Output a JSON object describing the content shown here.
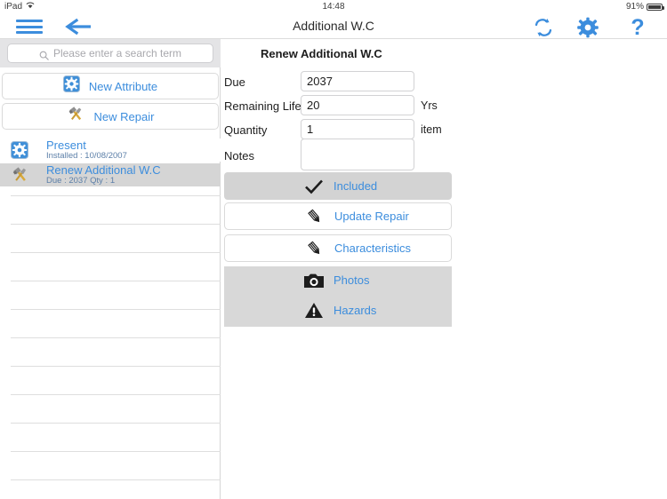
{
  "statusbar": {
    "device": "iPad",
    "wifi_icon": "wifi-icon",
    "time": "14:48",
    "battery_pct": "91%",
    "battery_icon": "battery-icon"
  },
  "navbar": {
    "menu_icon": "hamburger-menu-icon",
    "back_icon": "back-arrow-icon",
    "title": "Additional W.C",
    "sync_icon": "sync-icon",
    "settings_icon": "gear-icon",
    "help_icon": "question-mark-icon",
    "help_label": "?"
  },
  "sidebar": {
    "search": {
      "placeholder": "Please enter a search term",
      "value": "",
      "icon": "search-icon"
    },
    "actions": [
      {
        "label": "New Attribute",
        "icon": "blue-gear-square-icon"
      },
      {
        "label": "New Repair",
        "icon": "tools-icon"
      }
    ],
    "items": [
      {
        "title": "Present",
        "subtitle": "Installed : 10/08/2007",
        "icon": "blue-gear-square-icon",
        "selected": false
      },
      {
        "title": "Renew Additional W.C",
        "subtitle": "Due : 2037   Qty : 1",
        "icon": "tools-icon",
        "selected": true
      }
    ],
    "empty_row_count": 11
  },
  "detail": {
    "title": "Renew Additional W.C",
    "fields": [
      {
        "label": "Due",
        "value": "2037",
        "unit": ""
      },
      {
        "label": "Remaining Life",
        "value": "20",
        "unit": "Yrs"
      },
      {
        "label": "Quantity",
        "value": "1",
        "unit": "item"
      },
      {
        "label": "Notes",
        "value": "",
        "unit": ""
      }
    ],
    "buttons": [
      {
        "label": "Included",
        "icon": "checkmark-icon",
        "style": "gray"
      },
      {
        "label": "Update Repair",
        "icon": "pencil-icon",
        "style": "white"
      },
      {
        "label": "Characteristics",
        "icon": "pencil-icon",
        "style": "white"
      },
      {
        "label": "Photos",
        "icon": "camera-icon",
        "style": "gray"
      },
      {
        "label": "Hazards",
        "icon": "warning-triangle-icon",
        "style": "gray"
      }
    ]
  },
  "colors": {
    "accent_blue": "#3c8ddd",
    "selected_row_gray": "#d5d5d5",
    "panel_gray": "#d8d8d8",
    "search_band": "#e4e4e6"
  }
}
